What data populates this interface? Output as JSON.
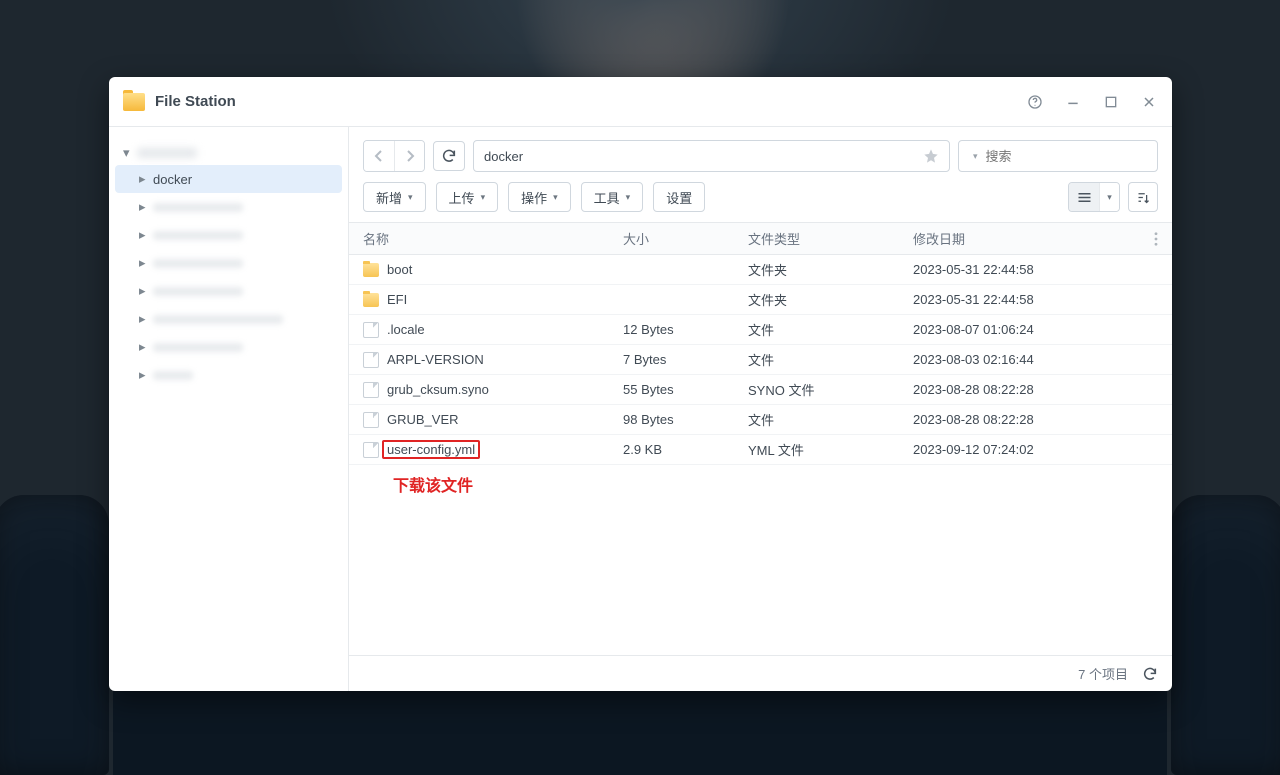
{
  "window": {
    "title": "File Station"
  },
  "sidebar": {
    "items": [
      {
        "label": "docker",
        "selected": true
      }
    ]
  },
  "toolbar": {
    "path": "docker",
    "search_placeholder": "搜索",
    "buttons": {
      "new": "新增",
      "upload": "上传",
      "action": "操作",
      "tool": "工具",
      "settings": "设置"
    }
  },
  "columns": {
    "name": "名称",
    "size": "大小",
    "type": "文件类型",
    "date": "修改日期"
  },
  "files": [
    {
      "name": "boot",
      "size": "",
      "type": "文件夹",
      "date": "2023-05-31 22:44:58",
      "icon": "folder"
    },
    {
      "name": "EFI",
      "size": "",
      "type": "文件夹",
      "date": "2023-05-31 22:44:58",
      "icon": "folder"
    },
    {
      "name": ".locale",
      "size": "12 Bytes",
      "type": "文件",
      "date": "2023-08-07 01:06:24",
      "icon": "file"
    },
    {
      "name": "ARPL-VERSION",
      "size": "7 Bytes",
      "type": "文件",
      "date": "2023-08-03 02:16:44",
      "icon": "file"
    },
    {
      "name": "grub_cksum.syno",
      "size": "55 Bytes",
      "type": "SYNO 文件",
      "date": "2023-08-28 08:22:28",
      "icon": "file"
    },
    {
      "name": "GRUB_VER",
      "size": "98 Bytes",
      "type": "文件",
      "date": "2023-08-28 08:22:28",
      "icon": "file"
    },
    {
      "name": "user-config.yml",
      "size": "2.9 KB",
      "type": "YML 文件",
      "date": "2023-09-12 07:24:02",
      "icon": "file",
      "outlined": true
    }
  ],
  "annotation": "下载该文件",
  "status": {
    "count_text": "7 个项目"
  }
}
